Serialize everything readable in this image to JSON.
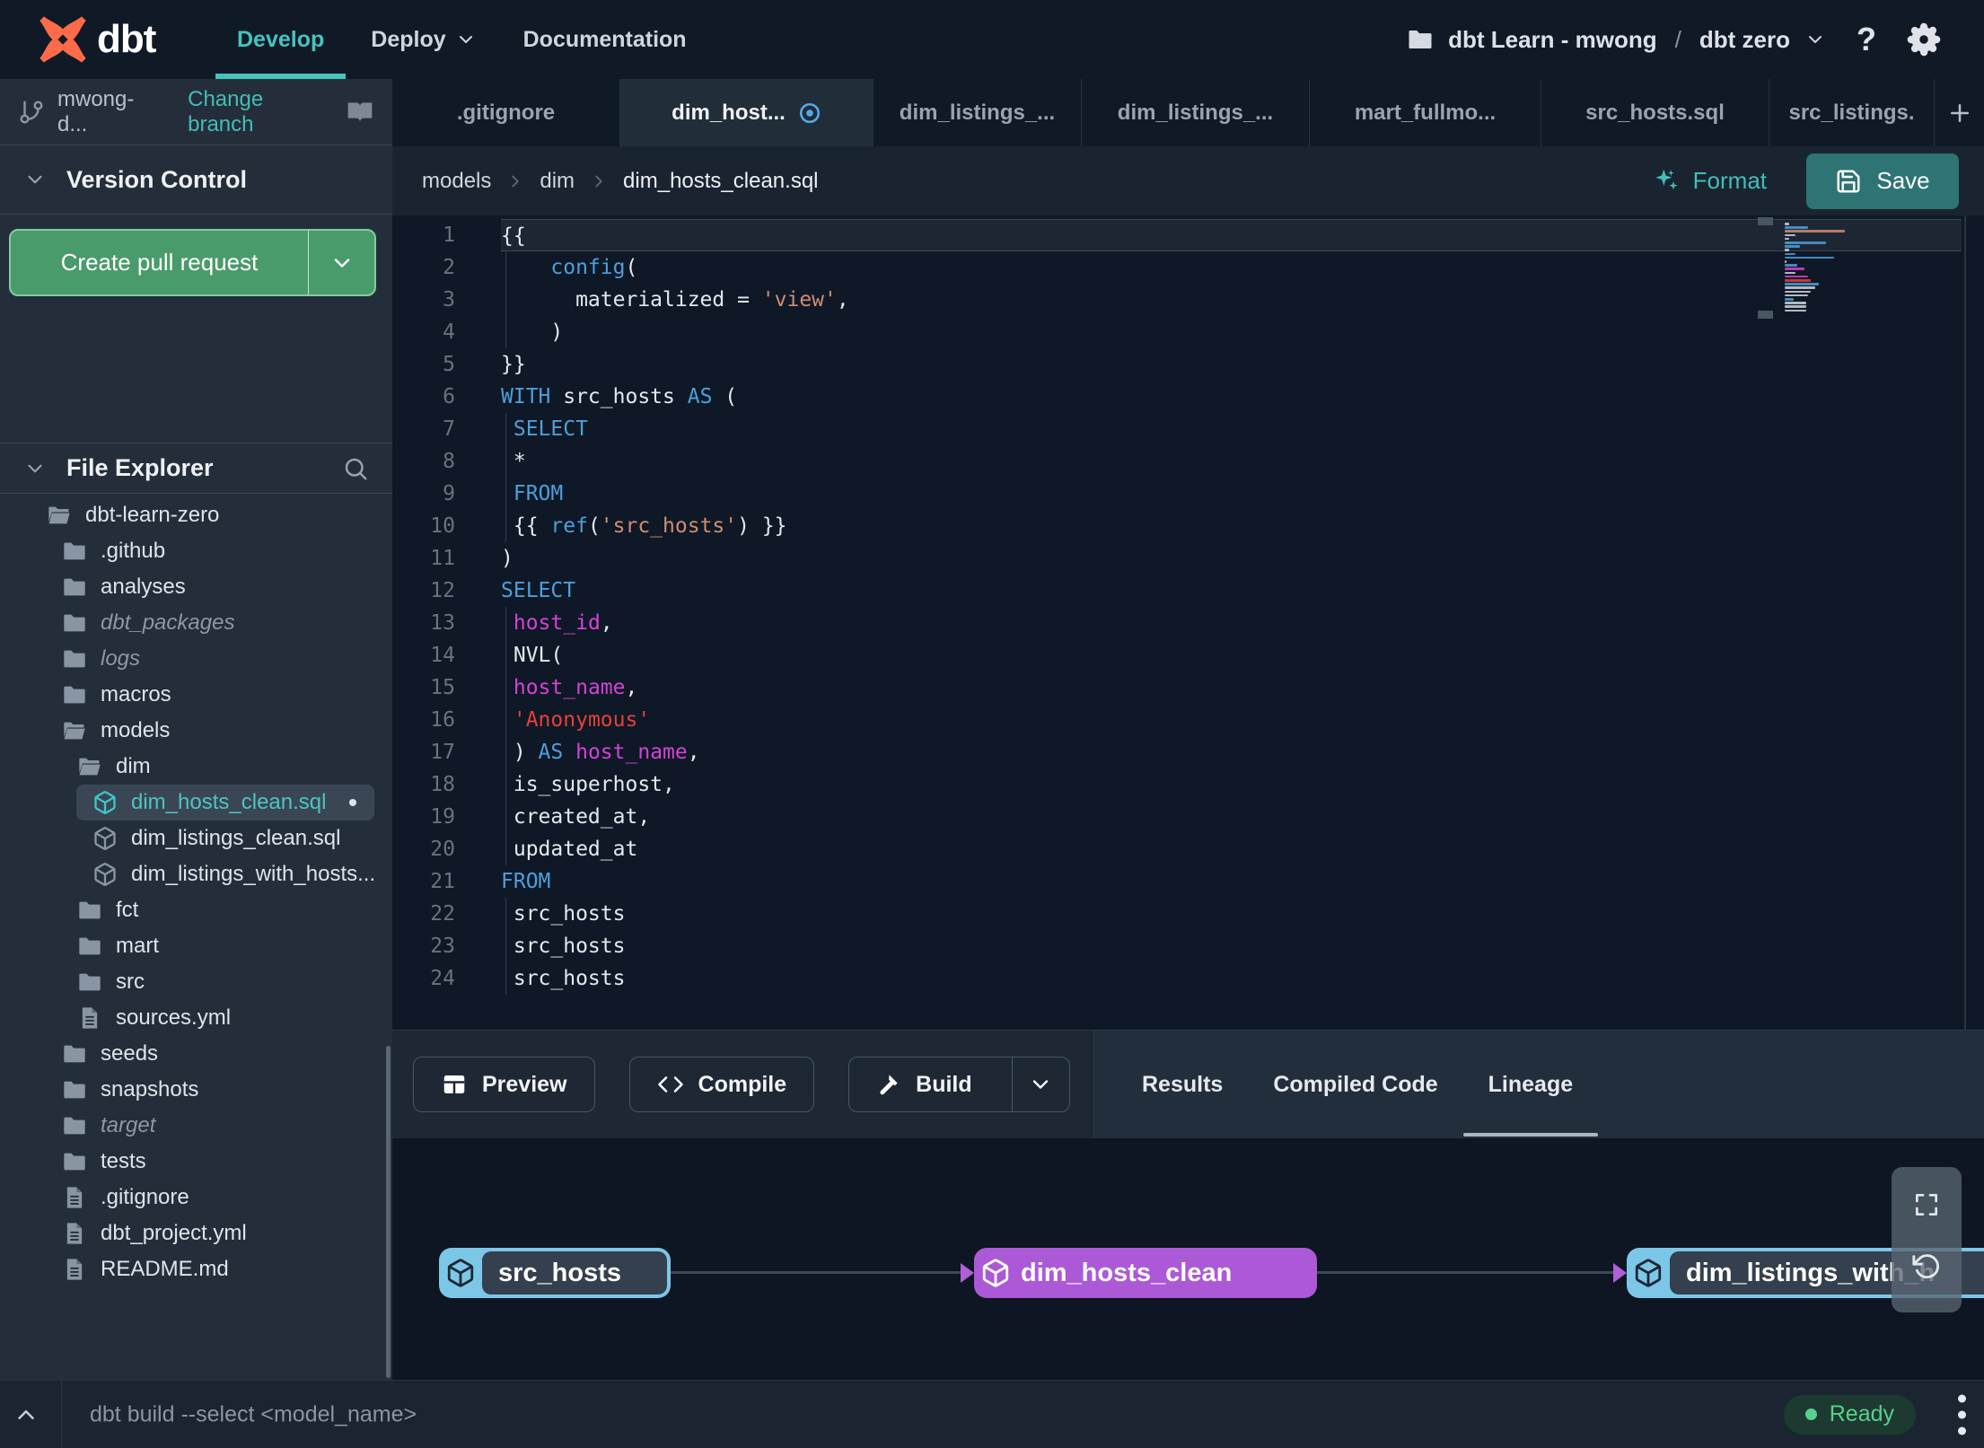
{
  "navbar": {
    "brand": "dbt",
    "items": [
      {
        "label": "Develop",
        "active": true,
        "chevron": false
      },
      {
        "label": "Deploy",
        "active": false,
        "chevron": true
      },
      {
        "label": "Documentation",
        "active": false,
        "chevron": false
      }
    ],
    "workspace": {
      "account": "dbt Learn - mwong",
      "separator": "/",
      "project": "dbt zero"
    }
  },
  "sidebar": {
    "branch_name": "mwong-d...",
    "change_branch_label": "Change branch",
    "version_control_title": "Version Control",
    "create_pr_label": "Create pull request",
    "file_explorer_title": "File Explorer",
    "tree": [
      {
        "label": "dbt-learn-zero",
        "icon": "folder-open",
        "depth": 0
      },
      {
        "label": ".github",
        "icon": "folder",
        "depth": 1
      },
      {
        "label": "analyses",
        "icon": "folder",
        "depth": 1
      },
      {
        "label": "dbt_packages",
        "icon": "folder",
        "depth": 1,
        "italic": true
      },
      {
        "label": "logs",
        "icon": "folder",
        "depth": 1,
        "italic": true
      },
      {
        "label": "macros",
        "icon": "folder",
        "depth": 1
      },
      {
        "label": "models",
        "icon": "folder-open",
        "depth": 1
      },
      {
        "label": "dim",
        "icon": "folder-open",
        "depth": 2
      },
      {
        "label": "dim_hosts_clean.sql",
        "icon": "model",
        "depth": 3,
        "selected": true,
        "dot": true
      },
      {
        "label": "dim_listings_clean.sql",
        "icon": "model",
        "depth": 3
      },
      {
        "label": "dim_listings_with_hosts...",
        "icon": "model",
        "depth": 3
      },
      {
        "label": "fct",
        "icon": "folder",
        "depth": 2
      },
      {
        "label": "mart",
        "icon": "folder",
        "depth": 2
      },
      {
        "label": "src",
        "icon": "folder",
        "depth": 2
      },
      {
        "label": "sources.yml",
        "icon": "file",
        "depth": 2
      },
      {
        "label": "seeds",
        "icon": "folder",
        "depth": 1
      },
      {
        "label": "snapshots",
        "icon": "folder",
        "depth": 1
      },
      {
        "label": "target",
        "icon": "folder",
        "depth": 1,
        "italic": true
      },
      {
        "label": "tests",
        "icon": "folder",
        "depth": 1
      },
      {
        "label": ".gitignore",
        "icon": "file",
        "depth": 1
      },
      {
        "label": "dbt_project.yml",
        "icon": "file",
        "depth": 1
      },
      {
        "label": "README.md",
        "icon": "file",
        "depth": 1
      }
    ]
  },
  "tabs": [
    {
      "label": ".gitignore"
    },
    {
      "label": "dim_host...",
      "active": true,
      "modified": true
    },
    {
      "label": "dim_listings_..."
    },
    {
      "label": "dim_listings_..."
    },
    {
      "label": "mart_fullmo..."
    },
    {
      "label": "src_hosts.sql"
    },
    {
      "label": "src_listings."
    }
  ],
  "editor": {
    "breadcrumb": [
      "models",
      "dim",
      "dim_hosts_clean.sql"
    ],
    "format_label": "Format",
    "save_label": "Save",
    "lines": [
      {
        "n": 1,
        "cur": true,
        "tokens": [
          [
            "{{",
            "p"
          ]
        ]
      },
      {
        "n": 2,
        "g": true,
        "tokens": [
          [
            "    ",
            "p"
          ],
          [
            "config",
            "k"
          ],
          [
            "(",
            "p"
          ]
        ]
      },
      {
        "n": 3,
        "g": true,
        "tokens": [
          [
            "      materialized = ",
            "p"
          ],
          [
            "'view'",
            "s"
          ],
          [
            ",",
            "p"
          ]
        ]
      },
      {
        "n": 4,
        "g": true,
        "tokens": [
          [
            "    )",
            "p"
          ]
        ]
      },
      {
        "n": 5,
        "tokens": [
          [
            "}}",
            "p"
          ]
        ]
      },
      {
        "n": 6,
        "tokens": [
          [
            "WITH",
            "k"
          ],
          [
            " src_hosts ",
            "p"
          ],
          [
            "AS",
            "k"
          ],
          [
            " (",
            "p"
          ]
        ]
      },
      {
        "n": 7,
        "g": true,
        "tokens": [
          [
            " ",
            "p"
          ],
          [
            "SELECT",
            "k"
          ]
        ]
      },
      {
        "n": 8,
        "g": true,
        "tokens": [
          [
            " *",
            "p"
          ]
        ]
      },
      {
        "n": 9,
        "g": true,
        "tokens": [
          [
            " ",
            "p"
          ],
          [
            "FROM",
            "k"
          ]
        ]
      },
      {
        "n": 10,
        "g": true,
        "tokens": [
          [
            " {{ ",
            "p"
          ],
          [
            "ref",
            "k"
          ],
          [
            "(",
            "p"
          ],
          [
            "'src_hosts'",
            "s"
          ],
          [
            ") }}",
            "p"
          ]
        ]
      },
      {
        "n": 11,
        "tokens": [
          [
            ")",
            "p"
          ]
        ]
      },
      {
        "n": 12,
        "tokens": [
          [
            "SELECT",
            "k"
          ]
        ]
      },
      {
        "n": 13,
        "g": true,
        "tokens": [
          [
            " ",
            "p"
          ],
          [
            "host_id",
            "v"
          ],
          [
            ",",
            "p"
          ]
        ]
      },
      {
        "n": 14,
        "g": true,
        "tokens": [
          [
            " NVL(",
            "p"
          ]
        ]
      },
      {
        "n": 15,
        "g": true,
        "tokens": [
          [
            " ",
            "p"
          ],
          [
            "host_name",
            "v"
          ],
          [
            ",",
            "p"
          ]
        ]
      },
      {
        "n": 16,
        "g": true,
        "tokens": [
          [
            " ",
            "p"
          ],
          [
            "'Anonymous'",
            "r"
          ]
        ]
      },
      {
        "n": 17,
        "g": true,
        "tokens": [
          [
            " ) ",
            "p"
          ],
          [
            "AS",
            "k"
          ],
          [
            " ",
            "p"
          ],
          [
            "host_name",
            "v"
          ],
          [
            ",",
            "p"
          ]
        ]
      },
      {
        "n": 18,
        "g": true,
        "tokens": [
          [
            " is_superhost,",
            "p"
          ]
        ]
      },
      {
        "n": 19,
        "g": true,
        "tokens": [
          [
            " created_at,",
            "p"
          ]
        ]
      },
      {
        "n": 20,
        "g": true,
        "tokens": [
          [
            " updated_at",
            "p"
          ]
        ]
      },
      {
        "n": 21,
        "tokens": [
          [
            "FROM",
            "k"
          ]
        ]
      },
      {
        "n": 22,
        "g": true,
        "tokens": [
          [
            " src_hosts",
            "p"
          ]
        ]
      },
      {
        "n": 23,
        "g": true,
        "tokens": [
          [
            " src_hosts",
            "p"
          ]
        ]
      },
      {
        "n": 24,
        "g": true,
        "tokens": [
          [
            " src_hosts",
            "p"
          ]
        ]
      }
    ]
  },
  "panel": {
    "actions": [
      {
        "label": "Preview",
        "icon": "grid"
      },
      {
        "label": "Compile",
        "icon": "code"
      },
      {
        "label": "Build",
        "icon": "hammer",
        "split": true
      }
    ],
    "tabs": [
      {
        "label": "Results",
        "active": false
      },
      {
        "label": "Compiled Code",
        "active": false
      },
      {
        "label": "Lineage",
        "active": true
      }
    ]
  },
  "lineage": {
    "nodes": [
      {
        "label": "src_hosts",
        "variant": "source"
      },
      {
        "label": "dim_hosts_clean",
        "variant": "selected"
      },
      {
        "label": "dim_listings_with_h",
        "variant": "source"
      }
    ]
  },
  "statusbar": {
    "command": "dbt build --select <model_name>",
    "status_label": "Ready"
  },
  "colors": {
    "accent_teal": "#45c4bd",
    "brand_orange": "#ff6a4b",
    "pr_green": "#4a9b6c",
    "save_teal": "#2e7474",
    "node_blue": "#7cc7e8",
    "node_purple": "#ab59d6",
    "ready_green": "#58d08d",
    "keyword_blue": "#4d9fdb",
    "ident_magenta": "#d343d6",
    "string_salmon": "#cf8d72",
    "string_red": "#e5403c"
  }
}
